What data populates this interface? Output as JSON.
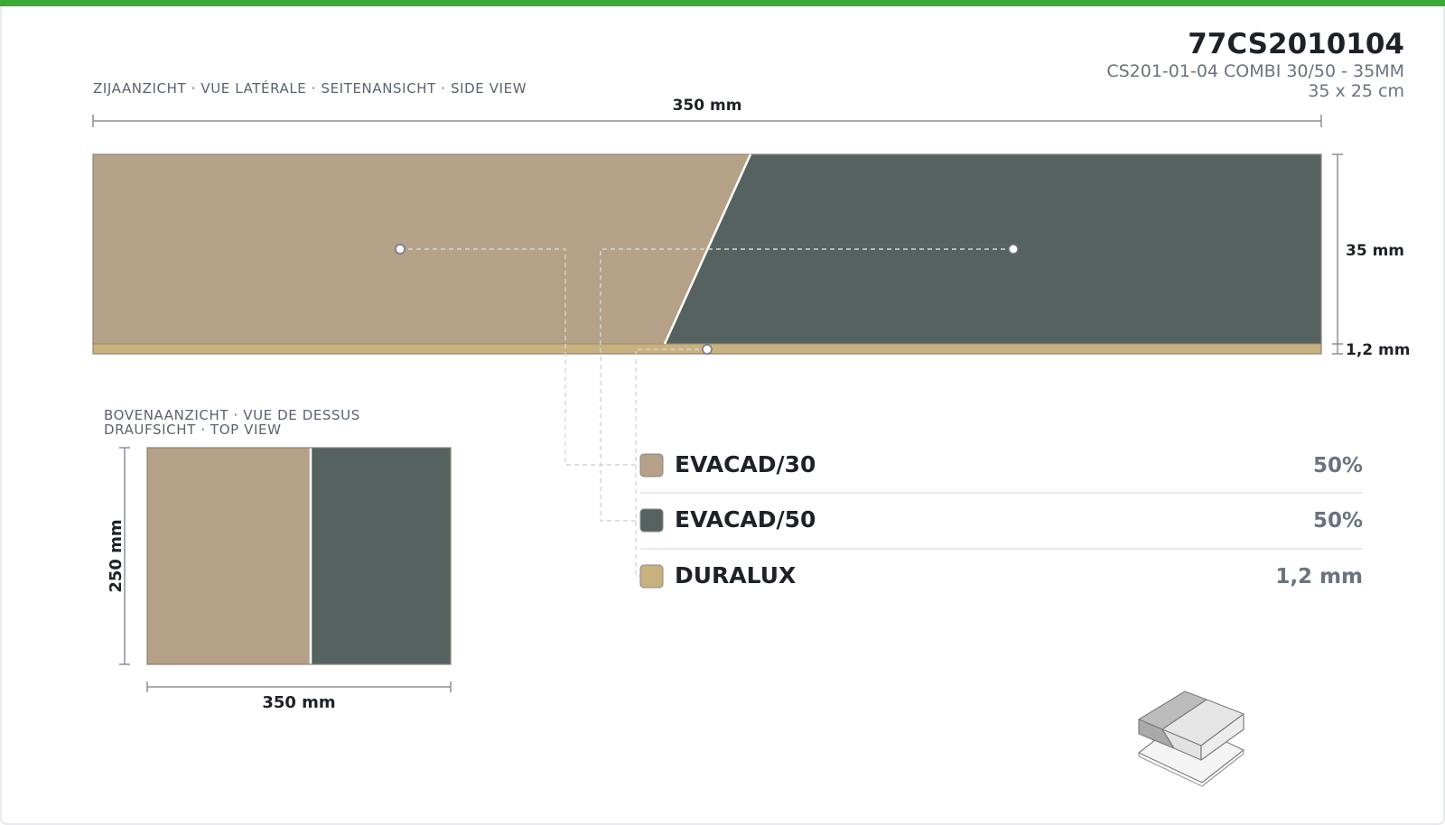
{
  "colors": {
    "top_bar": "#3aaa35",
    "evacad30": "#b5a188",
    "evacad50": "#56625f",
    "duralux": "#c9b17f",
    "text_dark": "#1e2228",
    "text_muted": "#6b7280",
    "line": "#8a8f98"
  },
  "header": {
    "code": "77CS2010104",
    "product": "CS201-01-04 COMBI 30/50 - 35MM",
    "size": "35 x 25 cm"
  },
  "side_view": {
    "label": "ZIJAANZICHT · VUE LATÉRALE · SEITENANSICHT · SIDE VIEW",
    "width_label": "350 mm",
    "height_label": "35 mm",
    "base_label": "1,2 mm"
  },
  "top_view": {
    "label_line1": "BOVENAANZICHT · VUE DE DESSUS",
    "label_line2": "DRAUFSICHT · TOP VIEW",
    "height_label": "250 mm",
    "width_label": "350 mm"
  },
  "legend": [
    {
      "name": "EVACAD/30",
      "value": "50%",
      "color": "#b5a188"
    },
    {
      "name": "EVACAD/50",
      "value": "50%",
      "color": "#56625f"
    },
    {
      "name": "DURALUX",
      "value": "1,2 mm",
      "color": "#c9b17f"
    }
  ],
  "icon": "combi-block-3d-icon"
}
